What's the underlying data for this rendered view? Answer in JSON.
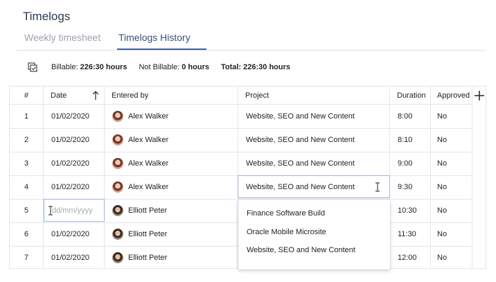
{
  "page_title": "Timelogs",
  "tabs": [
    {
      "label": "Weekly timesheet",
      "active": false
    },
    {
      "label": "Timelogs History",
      "active": true
    }
  ],
  "summary": {
    "billable_label": "Billable:",
    "billable_value": "226:30 hours",
    "not_billable_label": "Not Billable:",
    "not_billable_value": "0 hours",
    "total_label": "Total:",
    "total_value": "226:30 hours"
  },
  "columns": {
    "num": "#",
    "date": "Date",
    "entered_by": "Entered by",
    "project": "Project",
    "duration": "Duration",
    "approved": "Approved"
  },
  "rows": [
    {
      "num": "1",
      "date": "01/02/2020",
      "user": "Alex Walker",
      "project": "Website, SEO and New Content",
      "duration": "8:00",
      "approved": "No"
    },
    {
      "num": "2",
      "date": "01/02/2020",
      "user": "Alex Walker",
      "project": "Website, SEO and New Content",
      "duration": "8:10",
      "approved": "No"
    },
    {
      "num": "3",
      "date": "01/02/2020",
      "user": "Alex Walker",
      "project": "Website, SEO and New Content",
      "duration": "9:00",
      "approved": "No"
    },
    {
      "num": "4",
      "date": "01/02/2020",
      "user": "Alex Walker",
      "project": "Website, SEO and New Content",
      "duration": "9:30",
      "approved": "No"
    },
    {
      "num": "5",
      "date": "",
      "user": "Elliott Peter",
      "project": "",
      "duration": "10:30",
      "approved": "No"
    },
    {
      "num": "6",
      "date": "01/02/2020",
      "user": "Elliott Peter",
      "project": "",
      "duration": "11:30",
      "approved": "No"
    },
    {
      "num": "7",
      "date": "01/02/2020",
      "user": "Elliott Peter",
      "project": "",
      "duration": "12:00",
      "approved": "No"
    }
  ],
  "date_editor": {
    "placeholder": "dd/mm/yyyy"
  },
  "project_dropdown": {
    "options": [
      "Finance Software Build",
      "Oracle Mobile Microsite",
      "Website, SEO and New Content"
    ]
  },
  "icons": {
    "summary": "copy-select-icon",
    "sort": "arrow-up-icon",
    "add": "plus-icon",
    "cursor": "text-cursor-icon"
  },
  "colors": {
    "accent": "#3f5fa8",
    "title": "#2b3a55",
    "grid": "#e2e5ea"
  }
}
